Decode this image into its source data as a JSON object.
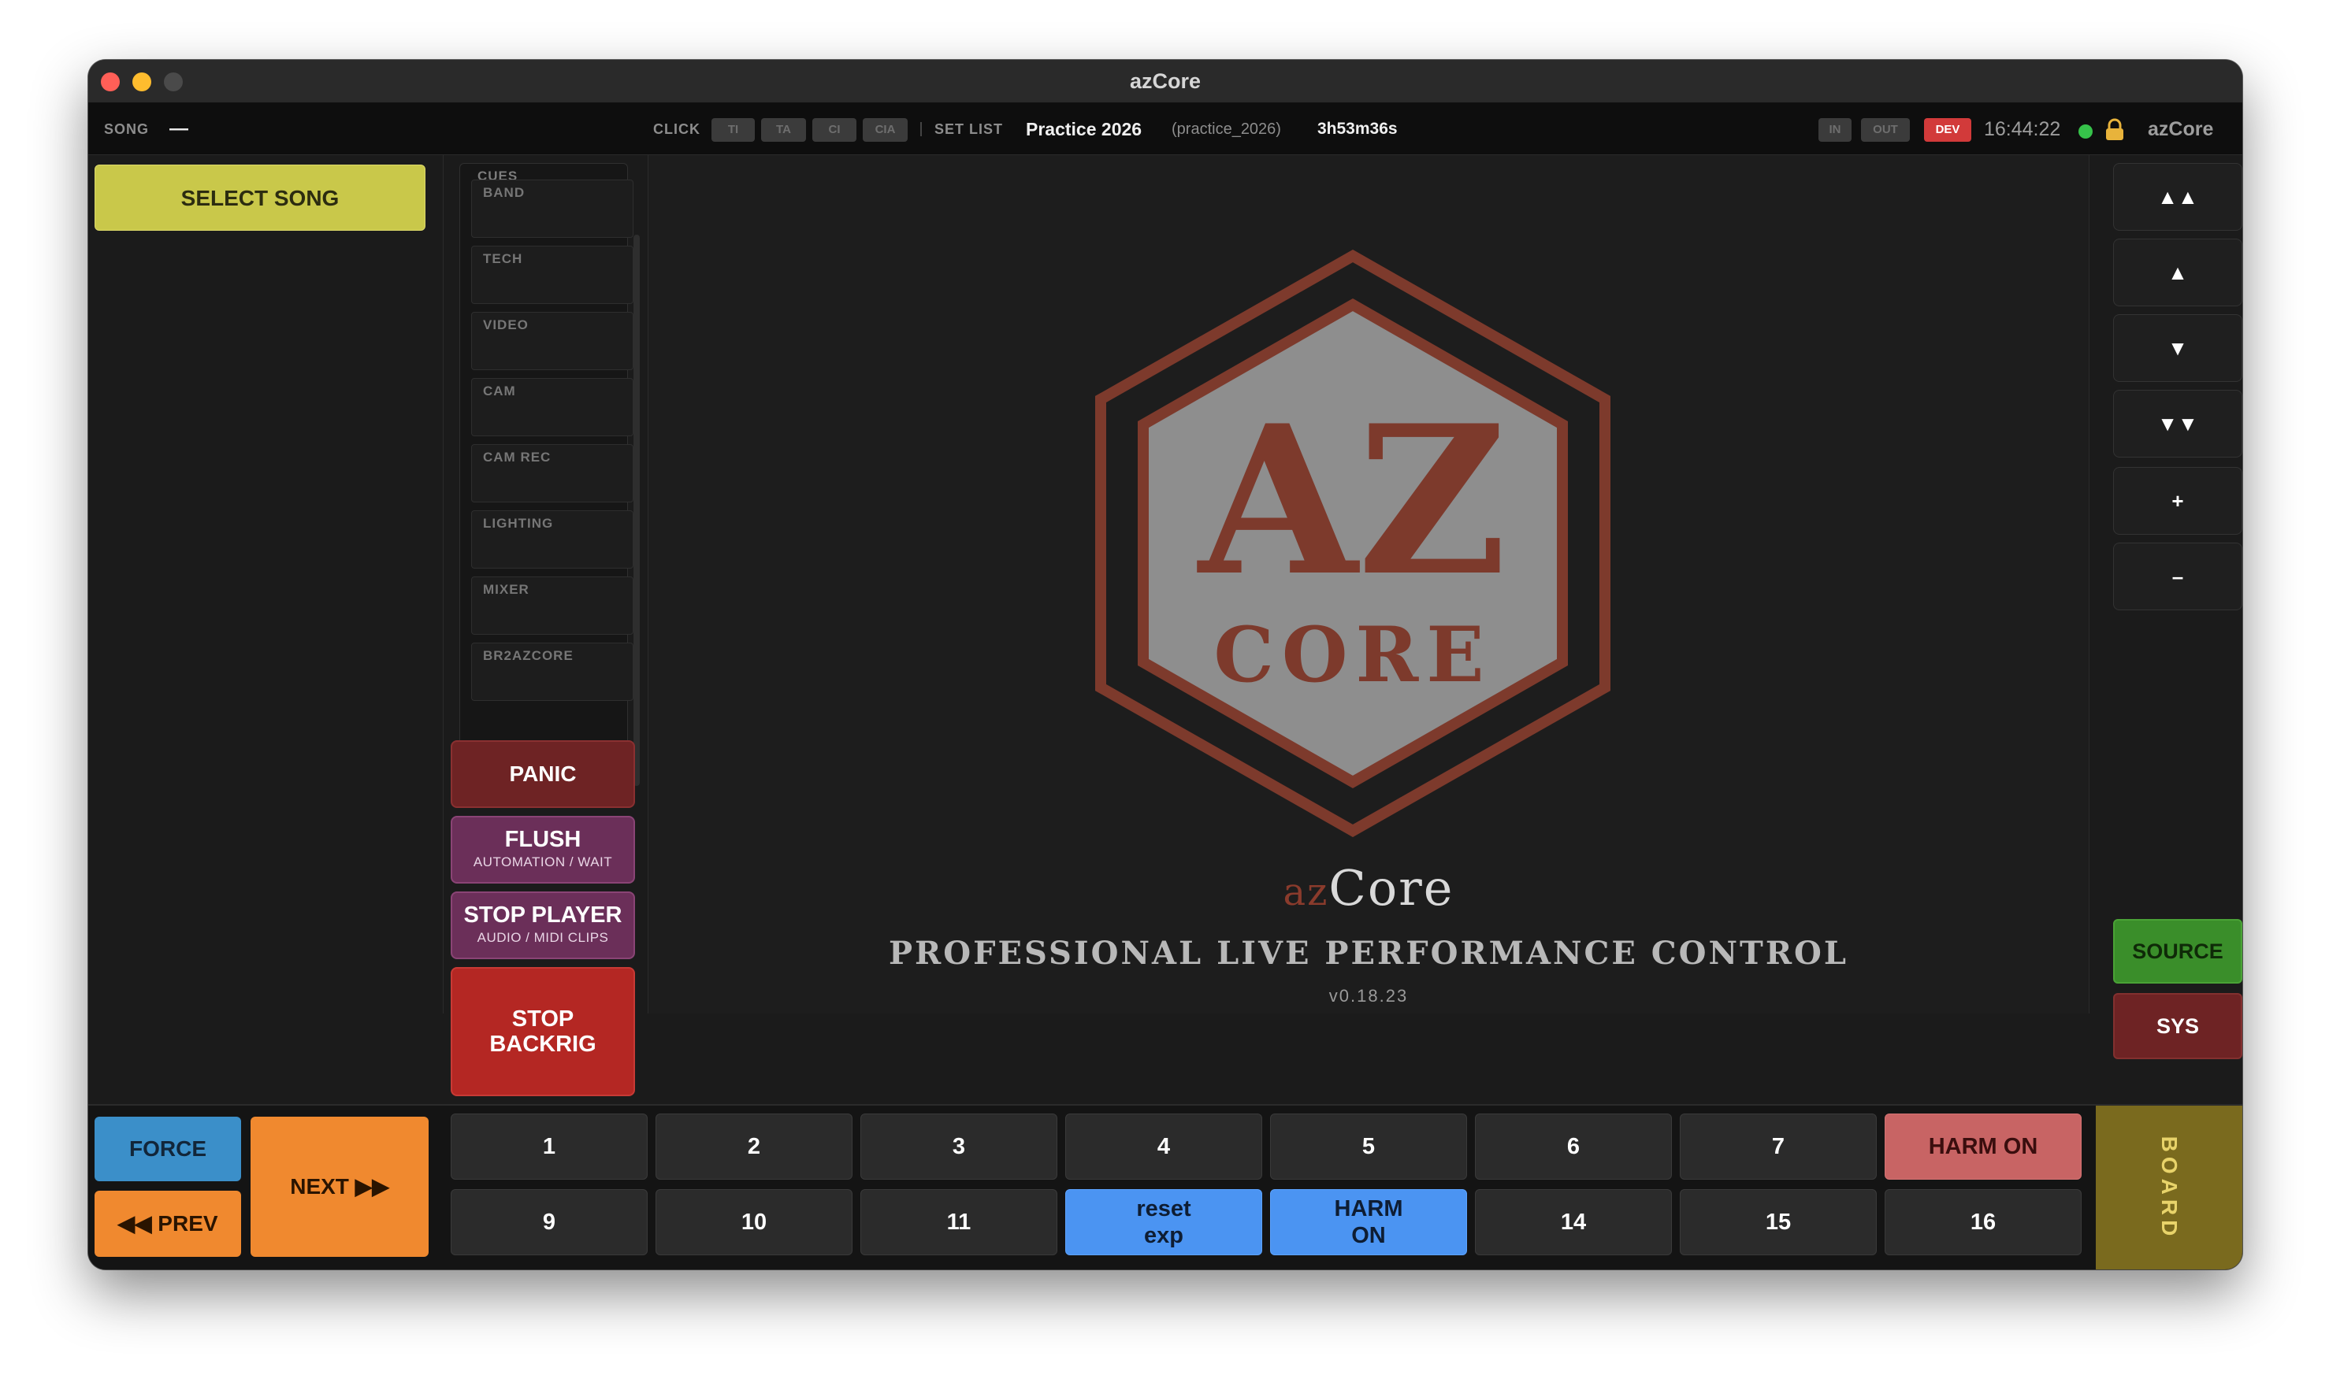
{
  "window": {
    "title": "azCore"
  },
  "statusbar": {
    "song_label": "SONG",
    "song_value": "—",
    "click_label": "CLICK",
    "click_chips": [
      "TI",
      "TA",
      "CI",
      "CIA"
    ],
    "setlist_label": "SET LIST",
    "setlist_name": "Practice 2026",
    "setlist_id": "(practice_2026)",
    "duration": "3h53m36s",
    "in_label": "IN",
    "out_label": "OUT",
    "dev_label": "DEV",
    "clock": "16:44:22",
    "app_name": "azCore"
  },
  "left": {
    "select_song": "SELECT SONG"
  },
  "cues": {
    "title": "CUES",
    "items": [
      "BAND",
      "TECH",
      "VIDEO",
      "CAM",
      "CAM REC",
      "LIGHTING",
      "MIXER",
      "BR2AZCORE"
    ]
  },
  "actions": {
    "panic": "PANIC",
    "flush": {
      "label": "FLUSH",
      "sub": "AUTOMATION / WAIT"
    },
    "stop_player": {
      "label": "STOP PLAYER",
      "sub": "AUDIO / MIDI CLIPS"
    },
    "stop_backrig_1": "STOP",
    "stop_backrig_2": "BACKRIG"
  },
  "splash": {
    "logo_text_top": "AZ",
    "logo_text_bottom": "CORE",
    "brand_az": "az",
    "brand_core": "Core",
    "tagline": "PROFESSIONAL LIVE PERFORMANCE CONTROL",
    "version": "v0.18.23"
  },
  "nav": {
    "top": "▲▲",
    "up": "▲",
    "down": "▼",
    "bottom": "▼▼",
    "plus": "+",
    "minus": "–",
    "source": "SOURCE",
    "sys": "SYS"
  },
  "transport": {
    "force": "FORCE",
    "prev": "◀◀ PREV",
    "next": "NEXT ▶▶",
    "board": "BOARD"
  },
  "pads": {
    "row1": [
      "1",
      "2",
      "3",
      "4",
      "5",
      "6",
      "7",
      "HARM ON"
    ],
    "row2": [
      "9",
      "10",
      "11",
      "reset exp",
      "HARM ON",
      "14",
      "15",
      "16"
    ]
  },
  "colors": {
    "select_song": "#c9c84a",
    "panic": "#6e2324",
    "flush": "#6b2f59",
    "backrig": "#b42723",
    "source": "#3a8e2a",
    "force": "#3b8fc9",
    "next_prev": "#f0892f",
    "pad_blue": "#4b94f2",
    "pad_red": "#c86464",
    "board": "#7a6a1e",
    "logo_rust": "#7d3a2c",
    "logo_grey": "#8e8e8e"
  }
}
